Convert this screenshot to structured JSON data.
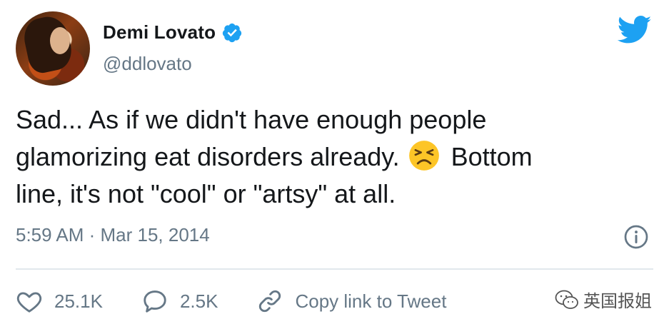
{
  "tweet": {
    "author_name": "Demi Lovato",
    "handle": "@ddlovato",
    "text_part1": "Sad... As if we didn't have enough people\nglamorizing eat disorders already.",
    "emoji": "persevering-face",
    "text_part2": "Bottom\nline, it's not \"cool\" or \"artsy\" at all.",
    "timestamp": "5:59 AM · Mar 15, 2014",
    "likes": "25.1K",
    "replies": "2.5K",
    "copy_link_label": "Copy link to Tweet"
  },
  "watermark": {
    "text": "英国报姐"
  },
  "icons": {
    "verified": "verified-badge-icon",
    "logo": "twitter-bird-icon",
    "info": "info-icon",
    "like": "heart-icon",
    "reply": "reply-bubble-icon",
    "copy_link": "link-icon",
    "watermark": "wechat-icon"
  },
  "colors": {
    "twitter_blue": "#1da1f2",
    "text_primary": "#14171a",
    "text_secondary": "#657786",
    "divider": "#e1e8ed"
  }
}
